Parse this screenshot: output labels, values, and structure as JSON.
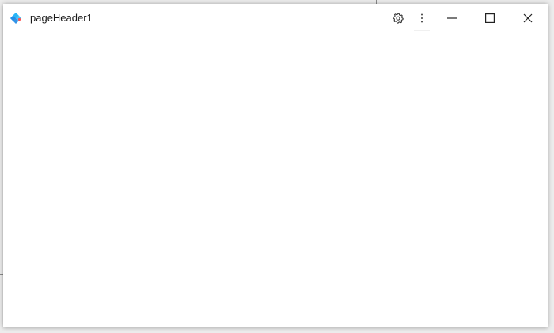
{
  "window": {
    "title": "pageHeader1",
    "icons": {
      "app": "app-logo-icon",
      "settings": "gear-icon",
      "more": "more-vertical-icon",
      "minimize": "minimize-icon",
      "maximize": "maximize-icon",
      "close": "close-icon"
    },
    "colors": {
      "logo_light": "#4fc3f7",
      "logo_dark": "#1976d2",
      "logo_accent": "#ff5252"
    }
  }
}
